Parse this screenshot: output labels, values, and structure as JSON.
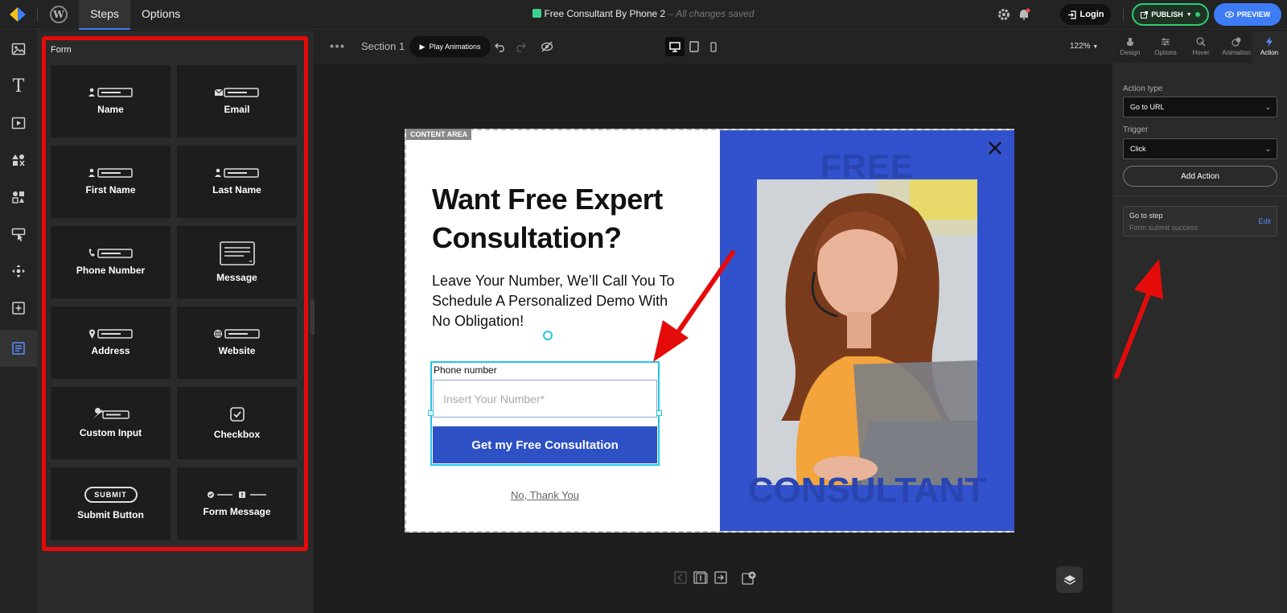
{
  "topbar": {
    "tabs": [
      "Steps",
      "Options"
    ],
    "doc_title": "Free Consultant By Phone 2",
    "save_status": "– All changes saved",
    "login_label": "Login",
    "publish_label": "PUBLISH",
    "preview_label": "PREVIEW"
  },
  "panel": {
    "title": "Form",
    "tiles": [
      {
        "label": "Name",
        "icon": "user-field-icon"
      },
      {
        "label": "Email",
        "icon": "email-field-icon"
      },
      {
        "label": "First Name",
        "icon": "user-field-icon"
      },
      {
        "label": "Last Name",
        "icon": "user-field-icon"
      },
      {
        "label": "Phone Number",
        "icon": "phone-field-icon"
      },
      {
        "label": "Message",
        "icon": "message-icon"
      },
      {
        "label": "Address",
        "icon": "location-field-icon"
      },
      {
        "label": "Website",
        "icon": "globe-field-icon"
      },
      {
        "label": "Custom Input",
        "icon": "wrench-field-icon"
      },
      {
        "label": "Checkbox",
        "icon": "checkbox-icon"
      },
      {
        "label": "Submit Button",
        "icon": "submit-button-icon",
        "badge": "SUBMIT"
      },
      {
        "label": "Form Message",
        "icon": "form-message-icon"
      }
    ]
  },
  "canvas": {
    "section_label": "Section 1",
    "play_label": "Play Animations",
    "zoom": "122%",
    "content_tag": "CONTENT AREA",
    "popup": {
      "headline": "Want Free Expert Consultation?",
      "subtext": "Leave Your Number, We’ll Call You To Schedule A Personalized Demo With No Obligation!",
      "field_label": "Phone number",
      "field_placeholder": "Insert Your Number*",
      "button_label": "Get my Free Consultation",
      "decline_label": "No, Thank You",
      "bg_word_top": "FREE",
      "bg_word_bottom": "CONSULTANT"
    }
  },
  "rightpanel": {
    "tabs": [
      "Design",
      "Options",
      "Hover",
      "Animation",
      "Action"
    ],
    "action_type_label": "Action type",
    "action_type_value": "Go to URL",
    "trigger_label": "Trigger",
    "trigger_value": "Click",
    "add_action_label": "Add Action",
    "step_card": {
      "title": "Go to step",
      "subtitle": "Form submit success",
      "edit_label": "Edit"
    }
  },
  "colors": {
    "accent": "#3d7cf5",
    "highlight": "#e50b0b",
    "popup_blue": "#3152cc",
    "selection": "#22c6e6"
  }
}
